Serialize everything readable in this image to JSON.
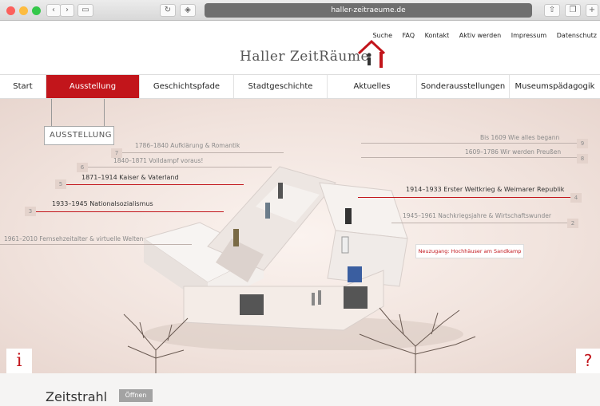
{
  "browser": {
    "url": "haller-zeitraeume.de"
  },
  "top_links": [
    "Suche",
    "FAQ",
    "Kontakt",
    "Aktiv werden",
    "Impressum",
    "Datenschutz"
  ],
  "logo": {
    "text": "Haller ZeitRäume"
  },
  "nav": [
    {
      "label": "Start",
      "active": false
    },
    {
      "label": "Ausstellung",
      "active": true
    },
    {
      "label": "Geschichtspfade",
      "active": false
    },
    {
      "label": "Stadtgeschichte",
      "active": false
    },
    {
      "label": "Aktuelles",
      "active": false
    },
    {
      "label": "Sonderausstellungen",
      "active": false
    },
    {
      "label": "Museumspädagogik",
      "active": false
    }
  ],
  "stage": {
    "section_tag": "Ausstellung",
    "eras": [
      {
        "num": "9",
        "label": "Bis 1609 Wie alles begann"
      },
      {
        "num": "8",
        "label": "1609–1786 Wir werden Preußen"
      },
      {
        "num": "7",
        "label": "1786–1840 Aufklärung & Romantik"
      },
      {
        "num": "6",
        "label": "1840–1871 Volldampf voraus!"
      },
      {
        "num": "5",
        "label": "1871–1914 Kaiser & Vaterland"
      },
      {
        "num": "4",
        "label": "1914–1933 Erster Weltkrieg & Weimarer Republik"
      },
      {
        "num": "3",
        "label": "1933–1945 Nationalsozialismus"
      },
      {
        "num": "2",
        "label": "1945–1961 Nachkriegsjahre & Wirtschaftswunder"
      },
      {
        "num": "",
        "label": "1961–2010 Fernsehzeitalter & virtuelle Welten"
      }
    ],
    "neuzugang": "Neuzugang: Hochhäuser am Sandkamp",
    "info_icon": "i",
    "help_icon": "?"
  },
  "bottom": {
    "title": "Zeitstrahl",
    "button": "Öffnen"
  },
  "colors": {
    "accent": "#c2151b"
  }
}
